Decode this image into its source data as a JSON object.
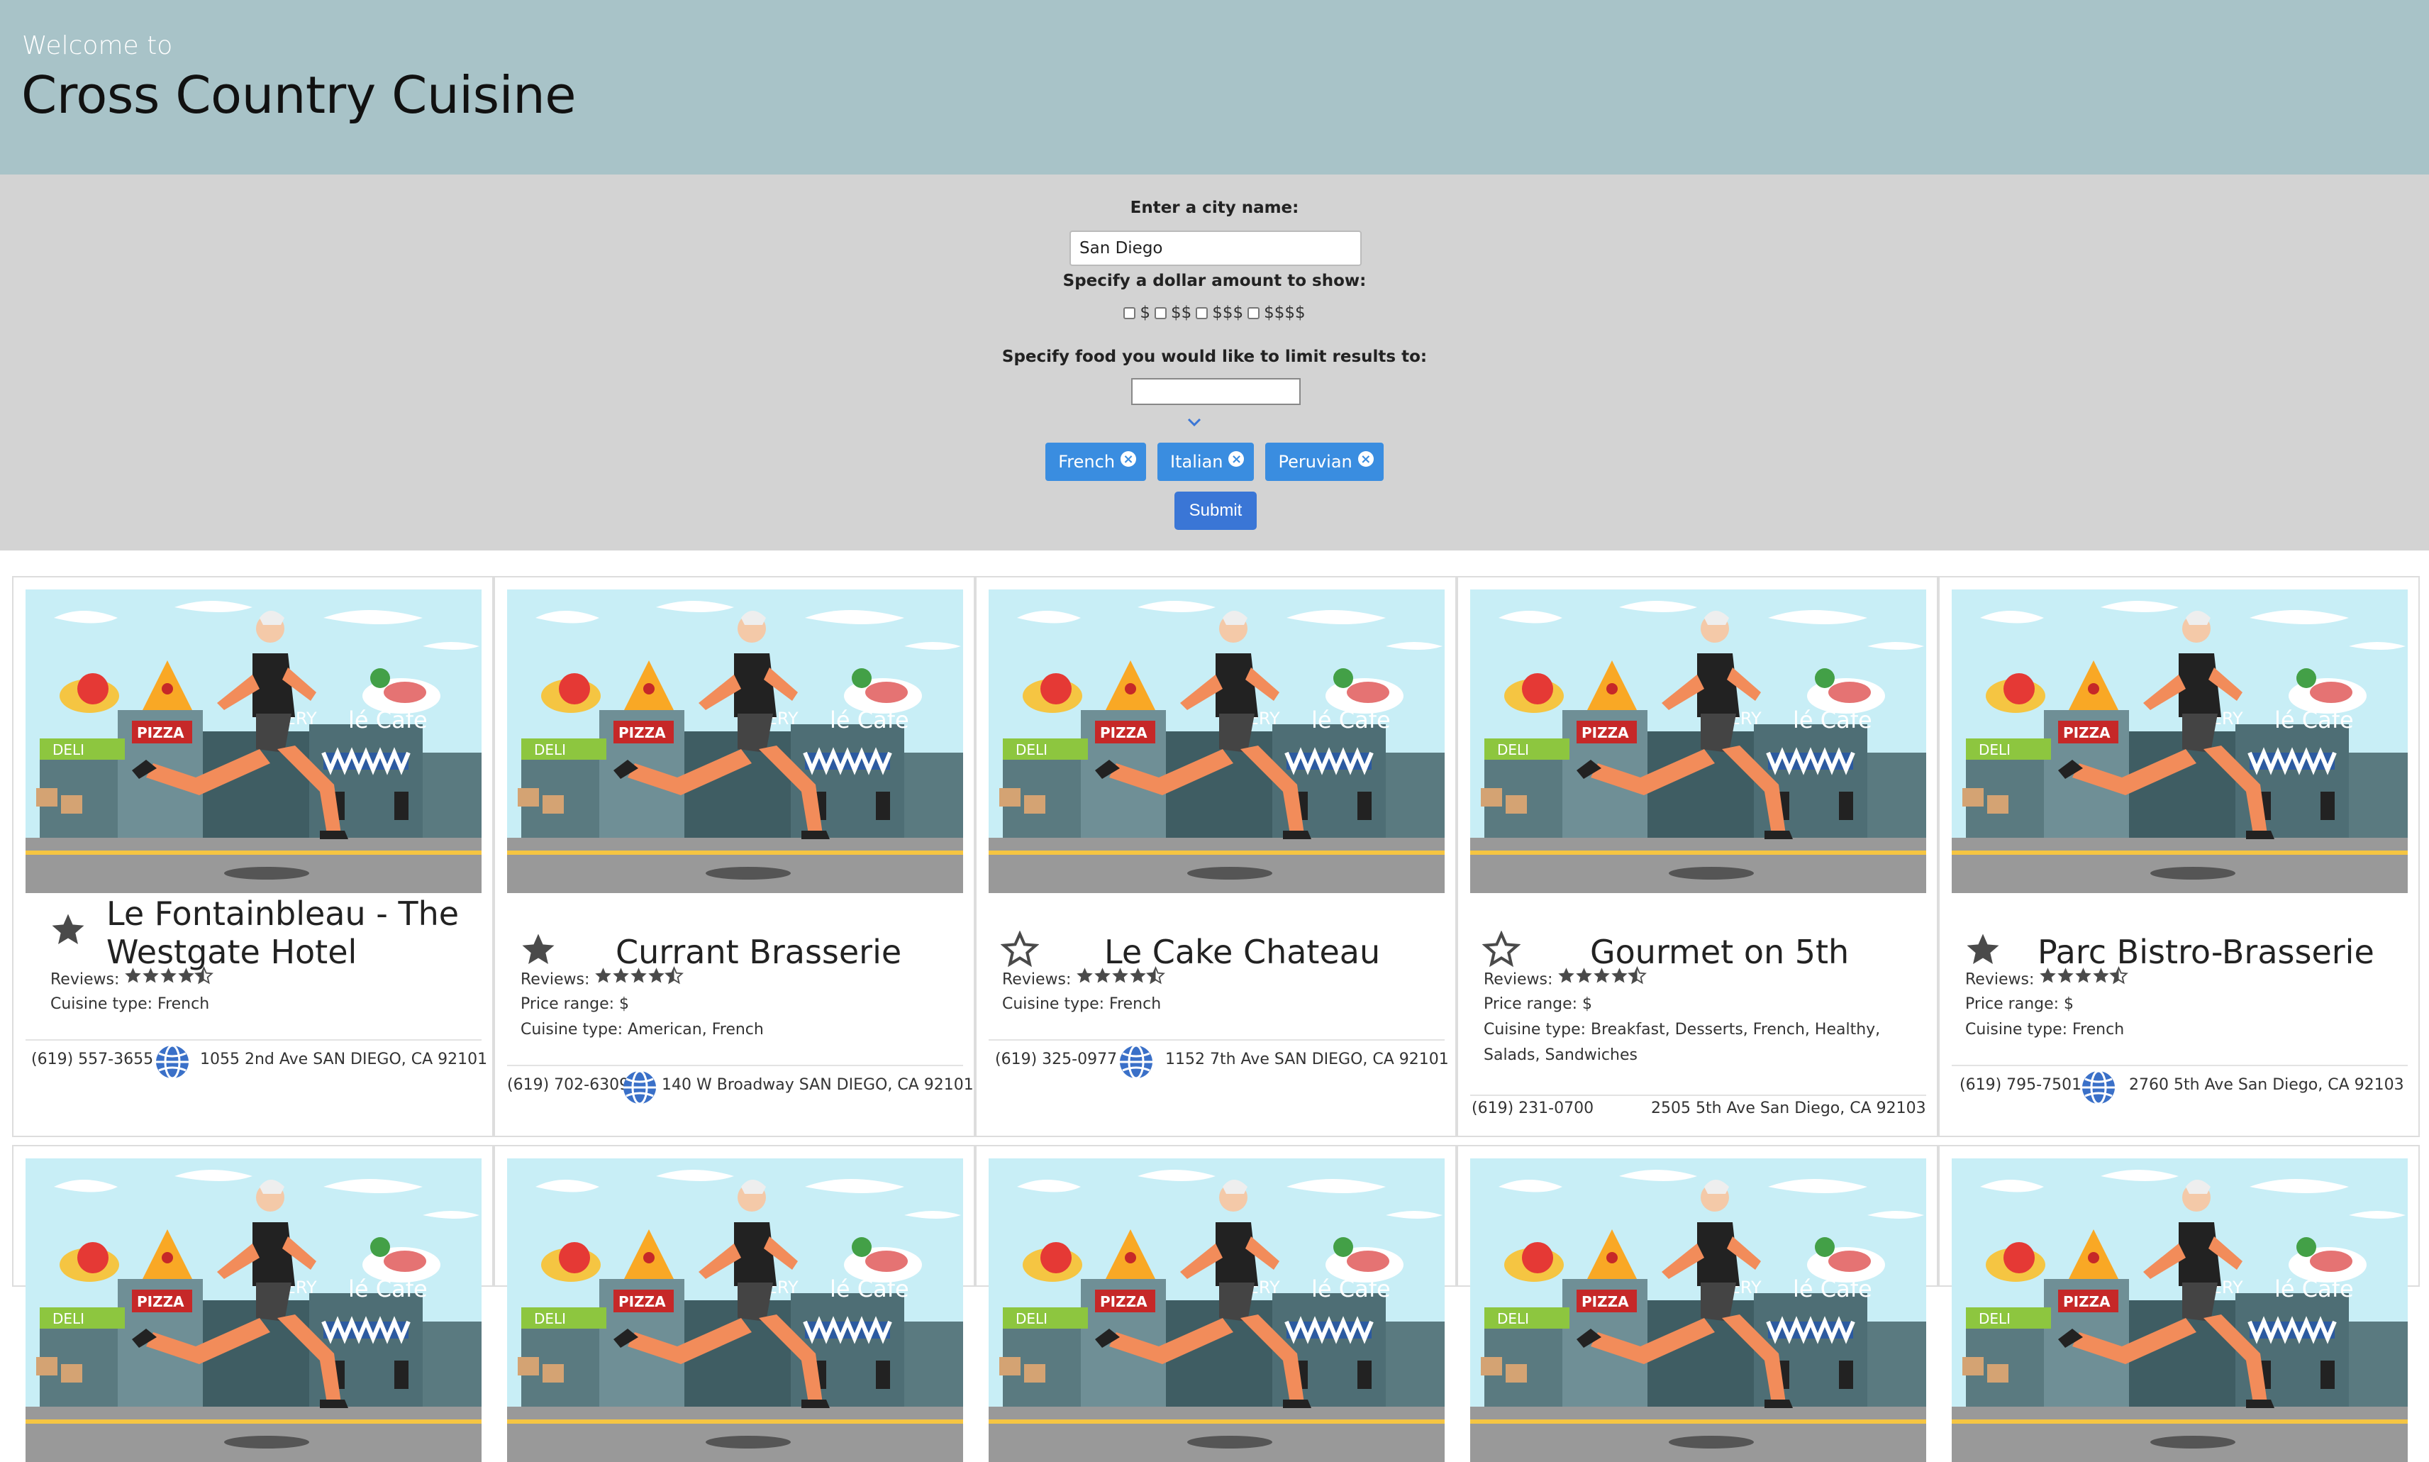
{
  "header": {
    "welcome": "Welcome to",
    "title": "Cross Country Cuisine"
  },
  "search": {
    "city_label": "Enter a city name:",
    "city_value": "San Diego",
    "price_label": "Specify a dollar amount to show:",
    "price_options": [
      "$",
      "$$",
      "$$$",
      "$$$$"
    ],
    "food_label": "Specify food you would like to limit results to:",
    "food_value": "",
    "tags": [
      "French",
      "Italian",
      "Peruvian"
    ],
    "submit_label": "Submit"
  },
  "labels": {
    "reviews": "Reviews:",
    "price": "Price range:",
    "cuisine": "Cuisine type:"
  },
  "colors": {
    "header_bg": "#a8c3c8",
    "search_bg": "#d3d3d3",
    "tag_bg": "#3a8de0",
    "submit_bg": "#3a76d6",
    "globe": "#3a70c8"
  },
  "restaurants": [
    {
      "name": "Le Fontainbleau - The Westgate Hotel",
      "name_line1": "Le Fontainbleau - The",
      "name_line2": "Westgate Hotel",
      "favorited": true,
      "rating": 4.5,
      "price": "",
      "cuisine": "French",
      "phone": "(619) 557-3655",
      "address": "1055 2nd Ave SAN DIEGO, CA 92101",
      "has_website": true
    },
    {
      "name": "Currant Brasserie",
      "favorited": true,
      "rating": 4.5,
      "price": "$",
      "cuisine": "American, French",
      "phone": "(619) 702-6309",
      "address": "140 W Broadway SAN DIEGO, CA 92101",
      "has_website": true
    },
    {
      "name": "Le Cake Chateau",
      "favorited": false,
      "rating": 4.5,
      "price": "",
      "cuisine": "French",
      "phone": "(619) 325-0977",
      "address": "1152 7th Ave SAN DIEGO, CA 92101",
      "has_website": true
    },
    {
      "name": "Gourmet on 5th",
      "favorited": false,
      "rating": 4.5,
      "price": "$",
      "cuisine_line1": "Cuisine type: Breakfast, Desserts, French, Healthy,",
      "cuisine_line2": "Salads, Sandwiches",
      "phone": "(619) 231-0700",
      "address": "2505 5th Ave San Diego, CA 92103",
      "has_website": false
    },
    {
      "name": "Parc Bistro-Brasserie",
      "favorited": true,
      "rating": 4.5,
      "price": "$",
      "cuisine": "French",
      "phone": "(619) 795-7501",
      "address": "2760 5th Ave San Diego, CA 92103",
      "has_website": true
    }
  ]
}
